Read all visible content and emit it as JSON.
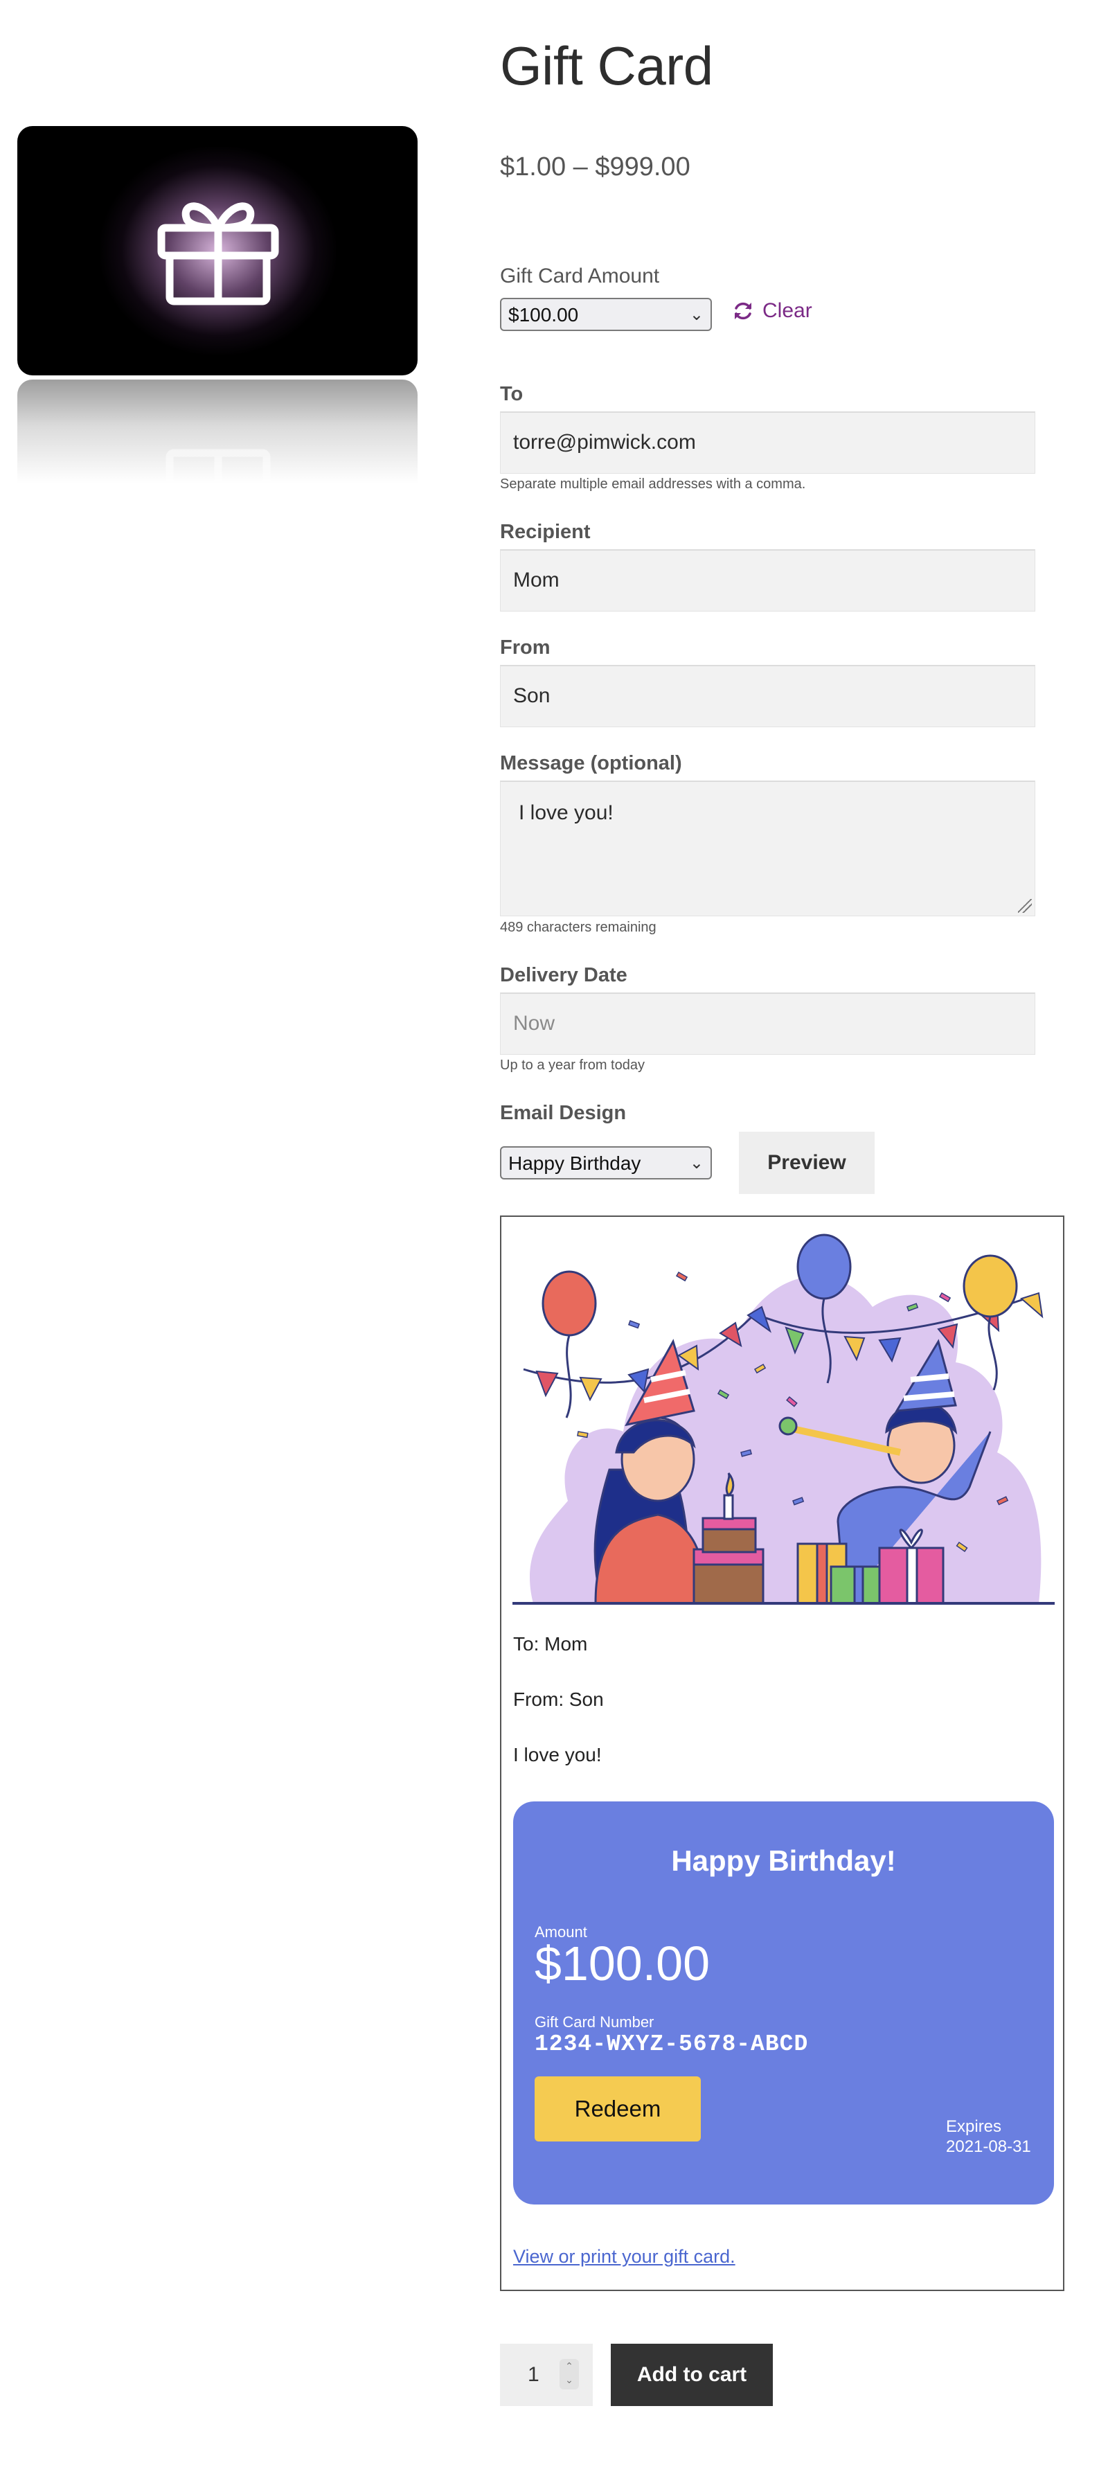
{
  "product": {
    "title": "Gift Card",
    "price_range": "$1.00 – $999.00",
    "image_icon": "gift-icon"
  },
  "form": {
    "amount_label": "Gift Card Amount",
    "amount_selected": "$100.00",
    "clear_label": "Clear",
    "to_label": "To",
    "to_value": "torre@pimwick.com",
    "to_hint": "Separate multiple email addresses with a comma.",
    "recipient_label": "Recipient",
    "recipient_value": "Mom",
    "from_label": "From",
    "from_value": "Son",
    "message_label": "Message (optional)",
    "message_value": "I love you!",
    "message_hint": "489 characters remaining",
    "delivery_label": "Delivery Date",
    "delivery_placeholder": "Now",
    "delivery_hint": "Up to a year from today",
    "design_label": "Email Design",
    "design_selected": "Happy Birthday",
    "preview_label": "Preview"
  },
  "email_preview": {
    "to_line": "To: Mom",
    "from_line": "From: Son",
    "message": "I love you!",
    "card": {
      "title": "Happy Birthday!",
      "amount_label": "Amount",
      "amount": "$100.00",
      "number_label": "Gift Card Number",
      "number": "1234-WXYZ-5678-ABCD",
      "redeem_label": "Redeem",
      "expires_label": "Expires",
      "expires_date": "2021-08-31"
    },
    "print_link": "View or print your gift card.",
    "colors": {
      "card_bg": "#6a7fe0",
      "redeem_bg": "#f5cb51",
      "link": "#4a66cf"
    }
  },
  "cart": {
    "quantity": "1",
    "add_to_cart_label": "Add to cart"
  },
  "colors": {
    "clear_link": "#7b2a86",
    "add_to_cart_bg": "#333333"
  }
}
